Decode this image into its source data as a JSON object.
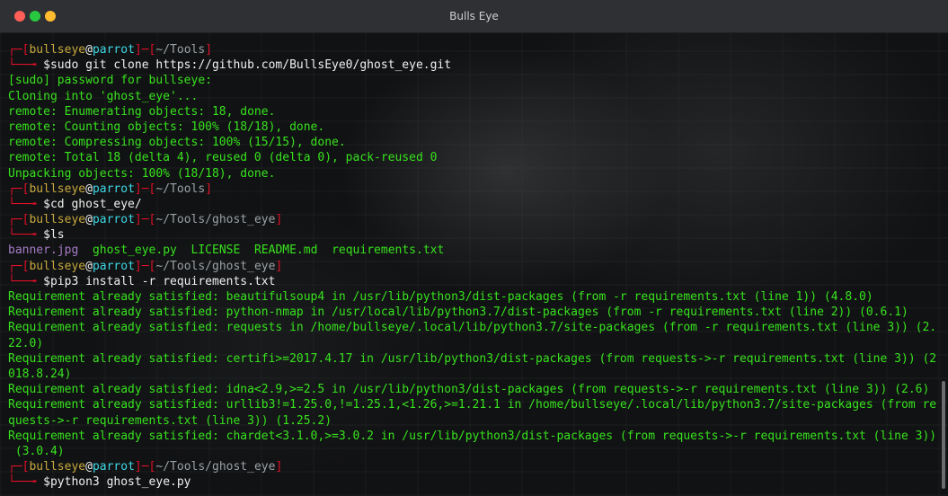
{
  "window": {
    "title": "Bulls Eye"
  },
  "prompt": {
    "user": "bullseye",
    "at": "@",
    "host": "parrot",
    "branch_top": "┌─",
    "branch_bottom": "└──╼ "
  },
  "lines": [
    {
      "kind": "prompt",
      "path": "~/Tools",
      "cmd": "$sudo git clone https://github.com/BullsEye0/ghost_eye.git"
    },
    {
      "kind": "out",
      "text": "[sudo] password for bullseye:"
    },
    {
      "kind": "out",
      "text": "Cloning into 'ghost_eye'..."
    },
    {
      "kind": "out",
      "text": "remote: Enumerating objects: 18, done."
    },
    {
      "kind": "out",
      "text": "remote: Counting objects: 100% (18/18), done."
    },
    {
      "kind": "out",
      "text": "remote: Compressing objects: 100% (15/15), done."
    },
    {
      "kind": "out",
      "text": "remote: Total 18 (delta 4), reused 0 (delta 0), pack-reused 0"
    },
    {
      "kind": "out",
      "text": "Unpacking objects: 100% (18/18), done."
    },
    {
      "kind": "prompt",
      "path": "~/Tools",
      "cmd": "$cd ghost_eye/"
    },
    {
      "kind": "prompt",
      "path": "~/Tools/ghost_eye",
      "cmd": "$ls"
    },
    {
      "kind": "ls",
      "files": [
        {
          "name": "banner.jpg",
          "color": "#a57cc7"
        },
        {
          "name": "ghost_eye.py",
          "color": "#37e31e"
        },
        {
          "name": "LICENSE",
          "color": "#37e31e"
        },
        {
          "name": "README.md",
          "color": "#37e31e"
        },
        {
          "name": "requirements.txt",
          "color": "#37e31e"
        }
      ]
    },
    {
      "kind": "prompt",
      "path": "~/Tools/ghost_eye",
      "cmd": "$pip3 install -r requirements.txt"
    },
    {
      "kind": "out",
      "text": "Requirement already satisfied: beautifulsoup4 in /usr/lib/python3/dist-packages (from -r requirements.txt (line 1)) (4.8.0)"
    },
    {
      "kind": "out",
      "text": "Requirement already satisfied: python-nmap in /usr/local/lib/python3.7/dist-packages (from -r requirements.txt (line 2)) (0.6.1)"
    },
    {
      "kind": "out",
      "text": "Requirement already satisfied: requests in /home/bullseye/.local/lib/python3.7/site-packages (from -r requirements.txt (line 3)) (2."
    },
    {
      "kind": "out",
      "text": "22.0)"
    },
    {
      "kind": "out",
      "text": "Requirement already satisfied: certifi>=2017.4.17 in /usr/lib/python3/dist-packages (from requests->-r requirements.txt (line 3)) (2"
    },
    {
      "kind": "out",
      "text": "018.8.24)"
    },
    {
      "kind": "out",
      "text": "Requirement already satisfied: idna<2.9,>=2.5 in /usr/lib/python3/dist-packages (from requests->-r requirements.txt (line 3)) (2.6)"
    },
    {
      "kind": "out",
      "text": "Requirement already satisfied: urllib3!=1.25.0,!=1.25.1,<1.26,>=1.21.1 in /home/bullseye/.local/lib/python3.7/site-packages (from re"
    },
    {
      "kind": "out",
      "text": "quests->-r requirements.txt (line 3)) (1.25.2)"
    },
    {
      "kind": "out",
      "text": "Requirement already satisfied: chardet<3.1.0,>=3.0.2 in /usr/lib/python3/dist-packages (from requests->-r requirements.txt (line 3))"
    },
    {
      "kind": "out",
      "text": " (3.0.4)"
    },
    {
      "kind": "prompt",
      "path": "~/Tools/ghost_eye",
      "cmd": "$python3 ghost_eye.py"
    }
  ]
}
